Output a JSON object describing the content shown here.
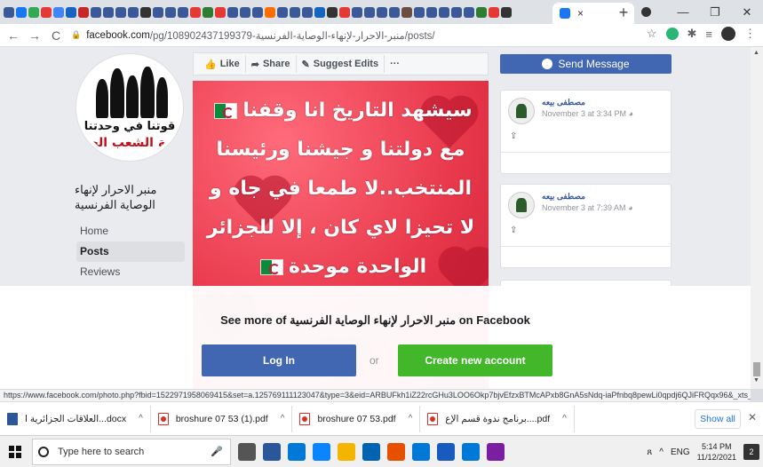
{
  "browser": {
    "tab_favicon_colors": [
      "#3b5998",
      "#1877f2",
      "#34a853",
      "#e53935",
      "#4285f4",
      "#1565c0",
      "#c62828",
      "#3b5998",
      "#3b5998",
      "#3b5998",
      "#3b5998",
      "#333333",
      "#3b5998",
      "#3b5998",
      "#3b5998",
      "#e53935",
      "#2e7d32",
      "#e53935",
      "#3b5998",
      "#3b5998",
      "#3b5998",
      "#ff6f00",
      "#3b5998",
      "#3b5998",
      "#3b5998",
      "#1565c0",
      "#333333",
      "#e53935",
      "#3b5998",
      "#3b5998",
      "#3b5998",
      "#3b5998",
      "#6d4c41",
      "#3b5998",
      "#3b5998",
      "#3b5998",
      "#3b5998",
      "#3b5998",
      "#2e7d32",
      "#e53935",
      "#333333"
    ],
    "active_tab": {
      "close_label": "×"
    },
    "new_tab_label": "+",
    "window_controls": {
      "minimize": "—",
      "maximize": "❐",
      "close": "✕"
    },
    "nav": {
      "back": "←",
      "forward": "→",
      "reload": "C"
    },
    "url": {
      "host": "facebook.com",
      "path": "/pg/108902437199379-منبر-الاحرار-لإنهاء-الوصاية-الفرنسية/posts/"
    },
    "status_url": "https://www.facebook.com/photo.php?fbid=1522971958069415&set=a.125769111123047&type=3&eid=ARBUFkh1iZ22rcGHu3LOO6Okp7bjvEfzxBTMcAPxb8GnA5sNdq-iaPfnbq8pewLi0qpdj6QJiFRQqx96&_xts_%5B0%5D=68.ARA9..."
  },
  "page": {
    "avatar": {
      "line1": "قوتنا في وحدتنا",
      "line2": "امة الشعب الجز"
    },
    "name": "منبر الاحرار لإنهاء الوصاية الفرنسية",
    "nav_items": [
      {
        "label": "Home"
      },
      {
        "label": "Posts"
      },
      {
        "label": "Reviews"
      }
    ],
    "actions": {
      "like": "Like",
      "share": "Share",
      "suggest": "Suggest Edits",
      "more": "···"
    },
    "post_text_lines": [
      "سيشهد التاريخ انا وقفنا",
      "مع دولتنا و جيشنا ورئيسنا",
      "المنتخب..لا طمعا في جاه و",
      "لا تحيزا لاي كان ، إلا للجزائر",
      "الواحدة موحدة"
    ],
    "send_message": "Send Message",
    "cards": [
      {
        "author": "مصطفى بيعه",
        "time": "November 3 at 3:34 PM"
      },
      {
        "author": "مصطفى بيعه",
        "time": "November 3 at 7:39 AM"
      }
    ]
  },
  "overlay": {
    "title_prefix": "See more of",
    "title_page": "منبر الاحرار لإنهاء الوصاية الفرنسية",
    "title_suffix": "on Facebook",
    "login": "Log In",
    "or": "or",
    "create": "Create new account"
  },
  "downloads": {
    "items": [
      {
        "name": "العلاقات الجزائرية ا...docx",
        "type": "word"
      },
      {
        "name": "broshure 07 53 (1).pdf",
        "type": "pdf"
      },
      {
        "name": "broshure 07 53.pdf",
        "type": "pdf"
      },
      {
        "name": "برنامج ندوة قسم الإع....pdf",
        "type": "pdf"
      }
    ],
    "show_all": "Show all",
    "close": "✕"
  },
  "taskbar": {
    "search_placeholder": "Type here to search",
    "app_colors": [
      "#555555",
      "#2b579a",
      "#0078d7",
      "#0a84ff",
      "#f4b400",
      "#0063b1",
      "#e65100",
      "#0078d7",
      "#185abd",
      "#0078d7",
      "#7b1fa2"
    ],
    "language": "ENG",
    "time": "5:14 PM",
    "date": "11/12/2021",
    "notifications": "2"
  }
}
